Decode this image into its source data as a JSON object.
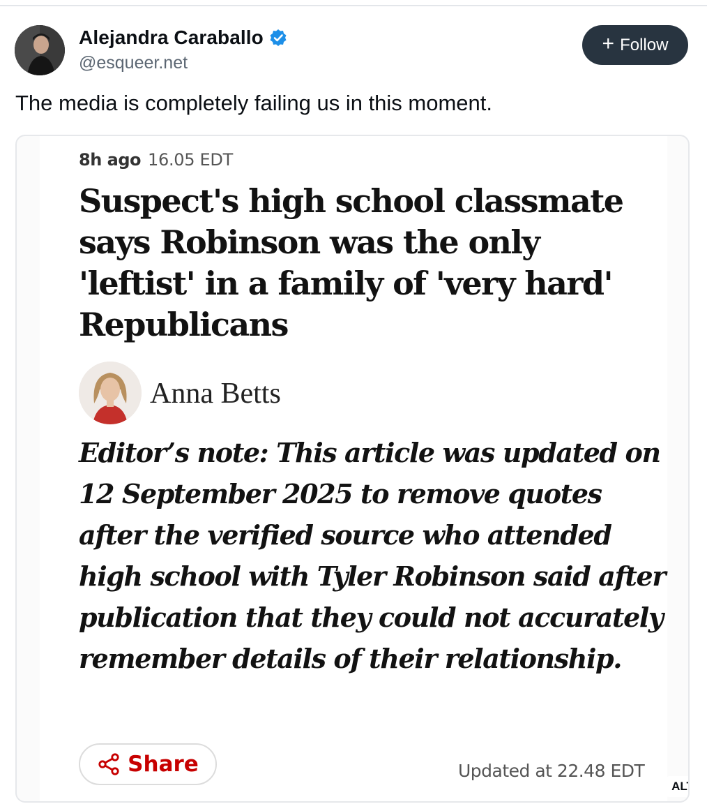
{
  "post": {
    "author_name": "Alejandra Caraballo",
    "handle": "@esqueer.net",
    "follow_label": "Follow",
    "text": "The media is completely failing us in this moment."
  },
  "embedded_article": {
    "time_ago": "8h ago",
    "time": "16.05 EDT",
    "headline": "Suspect's high school classmate says Robinson was the only 'leftist' in a family of 'very hard' Republicans",
    "byline": "Anna Betts",
    "editors_note": "Editor’s note: This article was updated on 12 September 2025 to remove quotes after the verified source who attended high school with Tyler Robinson said after publication that they could not accurately remember details of their relationship.",
    "share_label": "Share",
    "updated": "Updated at 22.48 EDT"
  },
  "alt_badge": "ALT",
  "icons": [
    "verified-icon",
    "plus-icon",
    "share-icon"
  ],
  "colors": {
    "follow_bg": "#283440",
    "verified": "#1d8fe8",
    "share_red": "#c70000"
  }
}
